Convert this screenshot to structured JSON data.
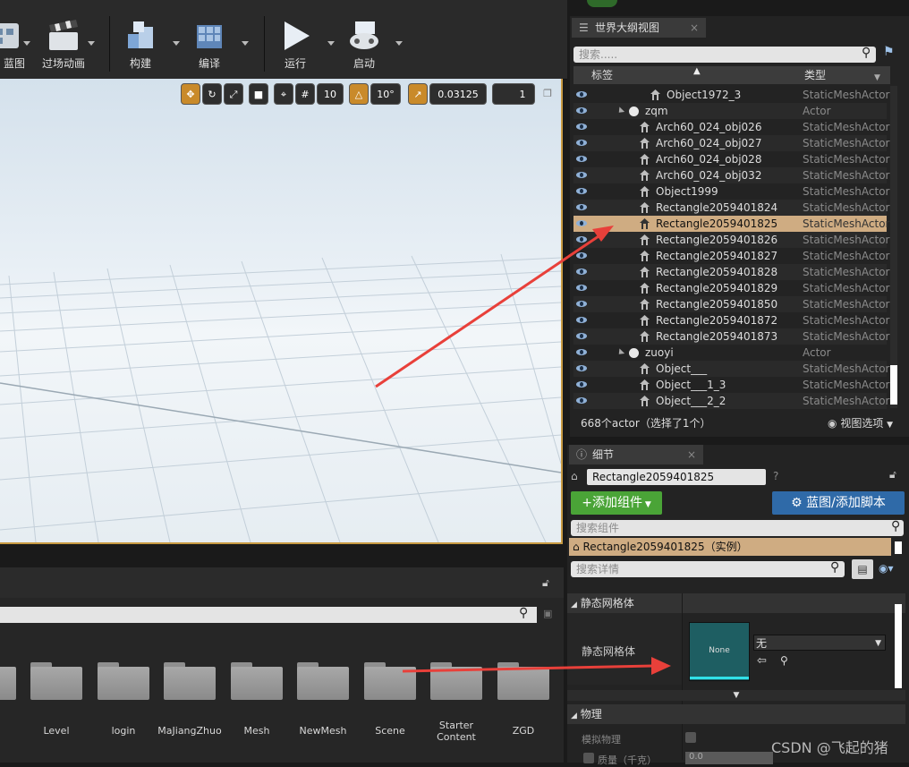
{
  "toolbar": {
    "buttons": [
      {
        "label": "蓝图"
      },
      {
        "label": "过场动画"
      },
      {
        "label": "构建"
      },
      {
        "label": "编译"
      },
      {
        "label": "运行"
      },
      {
        "label": "启动"
      }
    ]
  },
  "viewport": {
    "grid_snap": "10",
    "rotation_snap": "10°",
    "scale_snap": "0.03125",
    "camera_speed": "1"
  },
  "outliner": {
    "tab_title": "世界大纲视图",
    "search_placeholder": "搜索.....",
    "col_label": "标签",
    "col_type": "类型",
    "rows": [
      {
        "name": "Object1972_3",
        "type": "StaticMeshActor",
        "kind": "mesh",
        "indent": 3,
        "selected": false
      },
      {
        "name": "zqm",
        "type": "Actor",
        "kind": "folder",
        "indent": 1,
        "selected": false
      },
      {
        "name": "Arch60_024_obj026",
        "type": "StaticMeshActor",
        "kind": "mesh",
        "indent": 2,
        "selected": false
      },
      {
        "name": "Arch60_024_obj027",
        "type": "StaticMeshActor",
        "kind": "mesh",
        "indent": 2,
        "selected": false
      },
      {
        "name": "Arch60_024_obj028",
        "type": "StaticMeshActor",
        "kind": "mesh",
        "indent": 2,
        "selected": false
      },
      {
        "name": "Arch60_024_obj032",
        "type": "StaticMeshActor",
        "kind": "mesh",
        "indent": 2,
        "selected": false
      },
      {
        "name": "Object1999",
        "type": "StaticMeshActor",
        "kind": "mesh",
        "indent": 2,
        "selected": false
      },
      {
        "name": "Rectangle2059401824",
        "type": "StaticMeshActor",
        "kind": "mesh",
        "indent": 2,
        "selected": false
      },
      {
        "name": "Rectangle2059401825",
        "type": "StaticMeshActor",
        "kind": "mesh",
        "indent": 2,
        "selected": true
      },
      {
        "name": "Rectangle2059401826",
        "type": "StaticMeshActor",
        "kind": "mesh",
        "indent": 2,
        "selected": false
      },
      {
        "name": "Rectangle2059401827",
        "type": "StaticMeshActor",
        "kind": "mesh",
        "indent": 2,
        "selected": false
      },
      {
        "name": "Rectangle2059401828",
        "type": "StaticMeshActor",
        "kind": "mesh",
        "indent": 2,
        "selected": false
      },
      {
        "name": "Rectangle2059401829",
        "type": "StaticMeshActor",
        "kind": "mesh",
        "indent": 2,
        "selected": false
      },
      {
        "name": "Rectangle2059401850",
        "type": "StaticMeshActor",
        "kind": "mesh",
        "indent": 2,
        "selected": false
      },
      {
        "name": "Rectangle2059401872",
        "type": "StaticMeshActor",
        "kind": "mesh",
        "indent": 2,
        "selected": false
      },
      {
        "name": "Rectangle2059401873",
        "type": "StaticMeshActor",
        "kind": "mesh",
        "indent": 2,
        "selected": false
      },
      {
        "name": "zuoyi",
        "type": "Actor",
        "kind": "folder",
        "indent": 1,
        "selected": false
      },
      {
        "name": "Object___",
        "type": "StaticMeshActor",
        "kind": "mesh",
        "indent": 2,
        "selected": false
      },
      {
        "name": "Object___1_3",
        "type": "StaticMeshActor",
        "kind": "mesh",
        "indent": 2,
        "selected": false
      },
      {
        "name": "Object___2_2",
        "type": "StaticMeshActor",
        "kind": "mesh",
        "indent": 2,
        "selected": false
      }
    ],
    "status": "668个actor（选择了1个）",
    "view_options": "视图选项"
  },
  "details": {
    "tab_title": "细节",
    "actor_name": "Rectangle2059401825",
    "add_component": "添加组件",
    "blueprint_button": "蓝图/添加脚本",
    "search_components_placeholder": "搜索组件",
    "component_instance": "Rectangle2059401825（实例）",
    "search_details_placeholder": "搜索详情",
    "section_static_mesh": "静态网格体",
    "prop_static_mesh_label": "静态网格体",
    "mesh_thumb_label": "None",
    "mesh_value": "无",
    "section_physics": "物理",
    "prop_simulate_physics": "模拟物理",
    "prop_mass": "质量（千克）",
    "prop_mass_value": "0.0"
  },
  "content_browser": {
    "folders": [
      {
        "label": "Level"
      },
      {
        "label": "login"
      },
      {
        "label": "MaJiangZhuo"
      },
      {
        "label": "Mesh"
      },
      {
        "label": "NewMesh"
      },
      {
        "label": "Scene"
      },
      {
        "label": "Starter Content"
      },
      {
        "label": "ZGD"
      }
    ]
  },
  "watermark": "CSDN @飞起的猪",
  "colors": {
    "selection": "#cfac82",
    "viewport_border": "#c89a42",
    "add_component": "#4aa437",
    "blueprint": "#2f6aa8",
    "arrow": "#e8403a"
  }
}
